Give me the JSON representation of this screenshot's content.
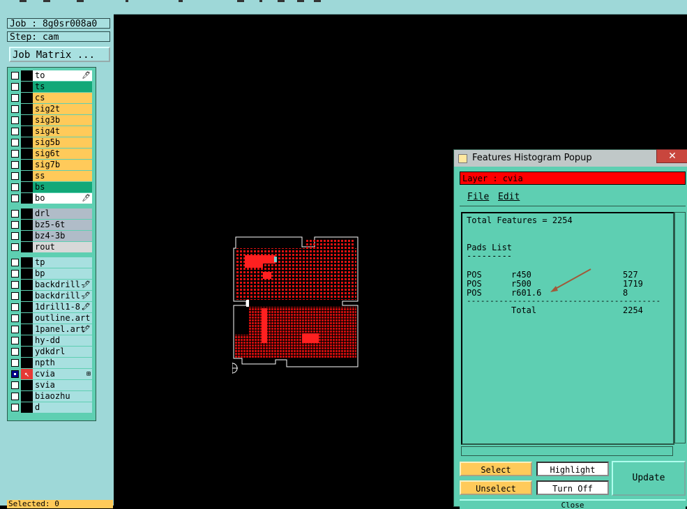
{
  "left_panel": {
    "job": "Job : 8g0sr008a0",
    "step": "Step: cam",
    "job_matrix_label": "Job Matrix ...",
    "layers": [
      {
        "name": "to",
        "color": "white",
        "mark": "🖊",
        "checked": false
      },
      {
        "name": "ts",
        "color": "green",
        "mark": "",
        "checked": false
      },
      {
        "name": "cs",
        "color": "yellow",
        "mark": "",
        "checked": false
      },
      {
        "name": "sig2t",
        "color": "yellow",
        "mark": "",
        "checked": false
      },
      {
        "name": "sig3b",
        "color": "yellow",
        "mark": "",
        "checked": false
      },
      {
        "name": "sig4t",
        "color": "yellow",
        "mark": "",
        "checked": false
      },
      {
        "name": "sig5b",
        "color": "yellow",
        "mark": "",
        "checked": false
      },
      {
        "name": "sig6t",
        "color": "yellow",
        "mark": "",
        "checked": false
      },
      {
        "name": "sig7b",
        "color": "yellow",
        "mark": "",
        "checked": false
      },
      {
        "name": "ss",
        "color": "yellow",
        "mark": "",
        "checked": false
      },
      {
        "name": "bs",
        "color": "green",
        "mark": "",
        "checked": false
      },
      {
        "name": "bo",
        "color": "white",
        "mark": "🖊",
        "checked": false
      },
      {
        "name": "drl",
        "color": "gray",
        "mark": "",
        "checked": false
      },
      {
        "name": "bz5-6t",
        "color": "gray",
        "mark": "",
        "checked": false
      },
      {
        "name": "bz4-3b",
        "color": "gray",
        "mark": "",
        "checked": false
      },
      {
        "name": "rout",
        "color": "lgray",
        "mark": "",
        "checked": false
      },
      {
        "name": "tp",
        "color": "aqua",
        "mark": "",
        "checked": false
      },
      {
        "name": "bp",
        "color": "aqua",
        "mark": "",
        "checked": false
      },
      {
        "name": "backdrill-",
        "color": "aqua",
        "mark": "🖊",
        "checked": false
      },
      {
        "name": "backdrill-",
        "color": "aqua",
        "mark": "🖊",
        "checked": false
      },
      {
        "name": "1drill1-8.",
        "color": "aqua",
        "mark": "🖊",
        "checked": false
      },
      {
        "name": "outline.art",
        "color": "aqua",
        "mark": "",
        "checked": false
      },
      {
        "name": "1panel.art",
        "color": "aqua",
        "mark": "🖊",
        "checked": false
      },
      {
        "name": "hy-dd",
        "color": "aqua",
        "mark": "",
        "checked": false
      },
      {
        "name": "ydkdrl",
        "color": "aqua",
        "mark": "",
        "checked": false
      },
      {
        "name": "npth",
        "color": "aqua",
        "mark": "",
        "checked": false
      },
      {
        "name": "cvia",
        "color": "aqua",
        "mark": "⊞",
        "checked": true,
        "active": true
      },
      {
        "name": "svia",
        "color": "aqua",
        "mark": "",
        "checked": false
      },
      {
        "name": "biaozhu",
        "color": "aqua",
        "mark": "",
        "checked": false
      },
      {
        "name": "d",
        "color": "aqua",
        "mark": "",
        "checked": false
      }
    ],
    "select_status": "Selected: 0"
  },
  "popup": {
    "title": "Features Histogram Popup",
    "close_label": "✕",
    "layer_label": "Layer :  cvia",
    "menu": {
      "file": "File",
      "edit": "Edit"
    },
    "total_features": "Total Features = 2254",
    "pads_heading": "Pads List",
    "pads_underline": "---------",
    "pads": [
      {
        "type": "POS",
        "sym": "r450",
        "count": "527"
      },
      {
        "type": "POS",
        "sym": "r500",
        "count": "1719"
      },
      {
        "type": "POS",
        "sym": "r601.6",
        "count": "8"
      }
    ],
    "separator": "------------------------------------------",
    "total_label": "Total",
    "total_value": "2254",
    "buttons": {
      "select": "Select",
      "highlight": "Highlight",
      "unselect": "Unselect",
      "turn_off": "Turn Off",
      "update": "Update",
      "close": "Close"
    }
  }
}
